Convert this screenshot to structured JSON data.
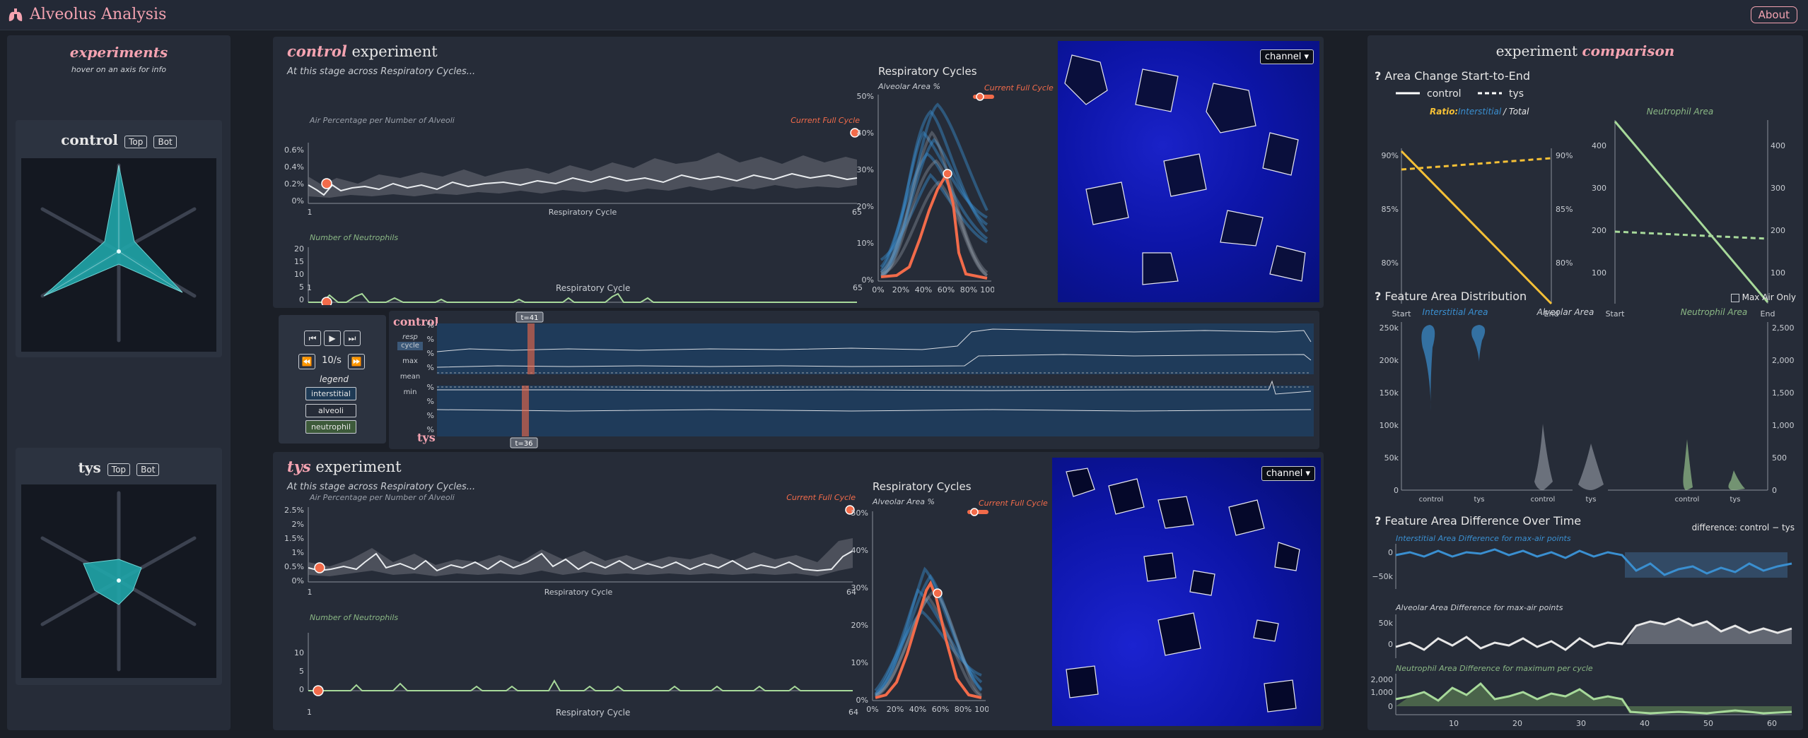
{
  "app": {
    "title": "Alveolus Analysis",
    "about": "About"
  },
  "left": {
    "title": "experiments",
    "subtitle": "hover on an axis for info",
    "cards": [
      {
        "name": "control",
        "top": "Top",
        "bot": "Bot"
      },
      {
        "name": "tys",
        "top": "Top",
        "bot": "Bot"
      }
    ]
  },
  "control_exp": {
    "name": "control",
    "suffix": "experiment",
    "stage": "At this stage across Respiratory Cycles...",
    "air_title": "Air Percentage per Number of Alveoli",
    "neut_title": "Number of Neutrophils",
    "current": "Current Full Cycle",
    "xlabel": "Respiratory Cycle",
    "x_first": "1",
    "x_last": "65",
    "air_ticks": [
      "0.6%",
      "0.4%",
      "0.2%",
      "0%"
    ],
    "neut_ticks": [
      "20",
      "15",
      "10",
      "5",
      "0"
    ],
    "resp_title": "Respiratory Cycles",
    "resp_sub": "Alveolar Area %",
    "resp_y": [
      "50%",
      "40%",
      "30%",
      "20%",
      "10%",
      "0%"
    ],
    "resp_x": [
      "0%",
      "20%",
      "40%",
      "60%",
      "80%",
      "100%"
    ],
    "channel": "channel ▾"
  },
  "tys_exp": {
    "name": "tys",
    "suffix": "experiment",
    "stage": "At this stage across Respiratory Cycles...",
    "air_title": "Air Percentage per Number of Alveoli",
    "neut_title": "Number of Neutrophils",
    "current": "Current Full Cycle",
    "xlabel": "Respiratory Cycle",
    "x_first": "1",
    "x_last": "64",
    "air_ticks": [
      "2.5%",
      "2%",
      "1.5%",
      "1%",
      "0.5%",
      "0%"
    ],
    "neut_ticks": [
      "10",
      "5",
      "0"
    ],
    "resp_title": "Respiratory Cycles",
    "resp_sub": "Alveolar Area %",
    "resp_y": [
      "50%",
      "40%",
      "30%",
      "20%",
      "10%",
      "0%"
    ],
    "resp_x": [
      "0%",
      "20%",
      "40%",
      "60%",
      "80%",
      "100%"
    ],
    "channel": "channel ▾"
  },
  "timeline": {
    "speed": "10/s",
    "legend": "legend",
    "chips": [
      "interstitial",
      "alveoli",
      "neutrophil"
    ],
    "resp": "resp",
    "cycle": "cycle",
    "max": "max",
    "mean": "mean",
    "min": "min",
    "control_label": "control",
    "tys_label": "tys",
    "t_control": "t=41",
    "t_tys": "t=36",
    "ticks_top": [
      "60%",
      "40%",
      "20%",
      "0%"
    ],
    "ticks_bot": [
      "0%",
      "20%",
      "40%",
      "60%"
    ]
  },
  "comparison": {
    "title_a": "experiment",
    "title_b": "comparison",
    "sec1": "Area Change Start-to-End",
    "legend_control": "control",
    "legend_tys": "tys",
    "ratio_a": "Ratio:",
    "ratio_b": "Interstitial",
    "ratio_c": "/ Total",
    "neut_area": "Neutrophil Area",
    "ratio_left_ticks": [
      "90%",
      "85%",
      "80%"
    ],
    "ratio_right_ticks": [
      "90%",
      "85%",
      "80%"
    ],
    "neut_left_ticks": [
      "400",
      "300",
      "200",
      "100"
    ],
    "neut_right_ticks": [
      "400",
      "300",
      "200",
      "100"
    ],
    "start": "Start",
    "end": "End",
    "sec2": "Feature Area Distribution",
    "max_air_only": "Max Air Only",
    "dist_titles": [
      "Interstitial Area",
      "Alveolar Area",
      "Neutrophil Area"
    ],
    "dist_left_ticks": [
      "250k",
      "200k",
      "150k",
      "100k",
      "50k",
      "0"
    ],
    "dist_right_ticks": [
      "2,500",
      "2,000",
      "1,500",
      "1,000",
      "500",
      "0"
    ],
    "dist_x": [
      "control",
      "tys",
      "control",
      "tys",
      "control",
      "tys"
    ],
    "sec3": "Feature Area Difference Over Time",
    "diff_label": "difference: control − tys",
    "d1": "Interstitial Area Difference for max-air points",
    "d2": "Alveolar Area Difference for max-air points",
    "d3": "Neutrophil Area Difference for maximum per cycle",
    "d1_ticks": [
      "0",
      "−50k"
    ],
    "d2_ticks": [
      "50k",
      "0"
    ],
    "d3_ticks": [
      "2,000",
      "1,000",
      "0"
    ],
    "x_ticks": [
      "10",
      "20",
      "30",
      "40",
      "50",
      "60"
    ]
  },
  "colors": {
    "accent": "#f4a3b1",
    "teal": "#1fa5a8",
    "orange": "#f26b4a",
    "yellow": "#f5c036",
    "green": "#a7d99a",
    "blue": "#3a8fd0"
  }
}
